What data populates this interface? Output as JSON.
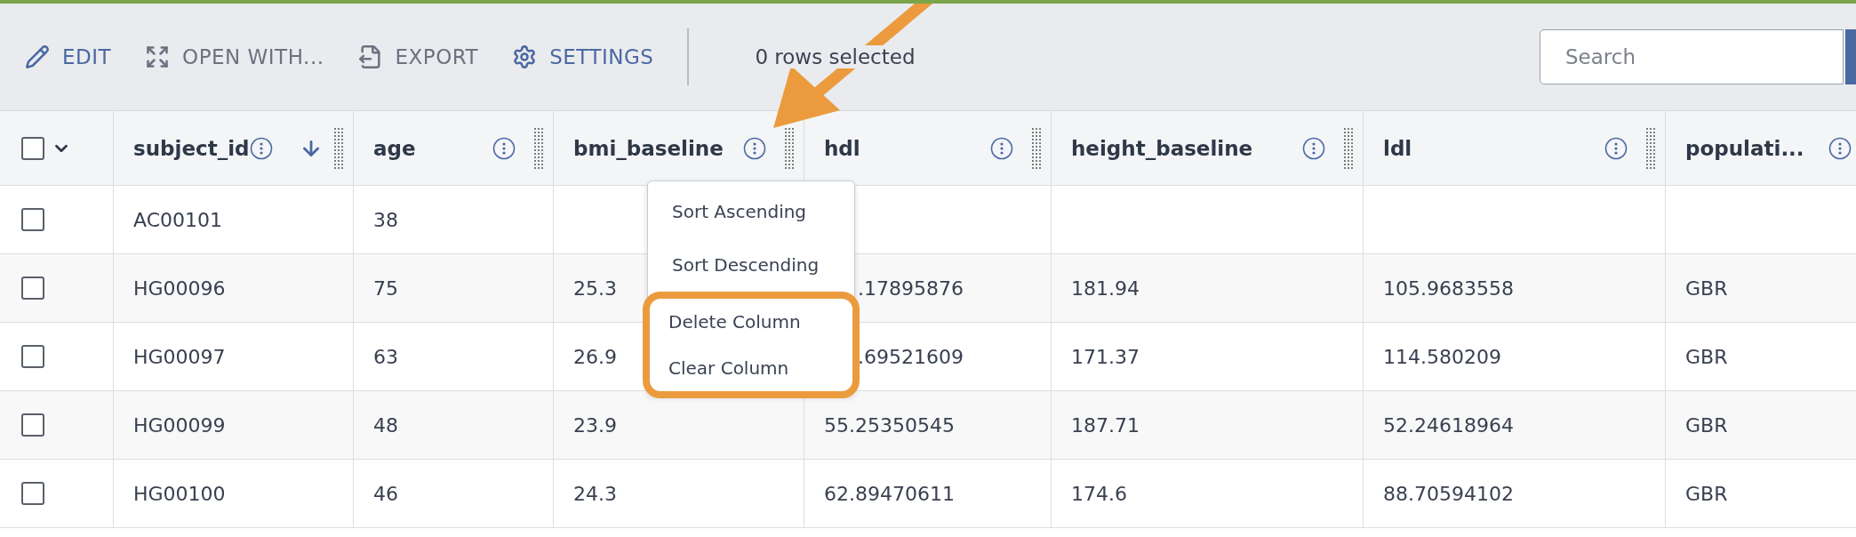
{
  "toolbar": {
    "actions": [
      {
        "label": "EDIT",
        "kind": "edit",
        "accent": true
      },
      {
        "label": "OPEN WITH...",
        "kind": "open",
        "accent": false
      },
      {
        "label": "EXPORT",
        "kind": "export",
        "accent": false
      },
      {
        "label": "SETTINGS",
        "kind": "settings",
        "accent": true
      }
    ],
    "selection_status": "0 rows selected",
    "search": {
      "placeholder": "Search"
    }
  },
  "table": {
    "select_all": {
      "checked": false
    },
    "columns": [
      {
        "label": "subject_id",
        "sorted": true
      },
      {
        "label": "age",
        "sorted": false
      },
      {
        "label": "bmi_baseline",
        "sorted": false
      },
      {
        "label": "hdl",
        "sorted": false
      },
      {
        "label": "height_baseline",
        "sorted": false
      },
      {
        "label": "ldl",
        "sorted": false
      },
      {
        "label": "populati...",
        "sorted": false
      }
    ],
    "rows": [
      {
        "selected": false,
        "menu_covers_hdl": false,
        "cells": [
          "AC00101",
          "38",
          "",
          "",
          "",
          "",
          ""
        ]
      },
      {
        "selected": false,
        "menu_covers_hdl": true,
        "cells": [
          "HG00096",
          "75",
          "25.3",
          ".17895876",
          "181.94",
          "105.9683558",
          "GBR"
        ]
      },
      {
        "selected": false,
        "menu_covers_hdl": true,
        "cells": [
          "HG00097",
          "63",
          "26.9",
          ".69521609",
          "171.37",
          "114.580209",
          "GBR"
        ]
      },
      {
        "selected": false,
        "menu_covers_hdl": false,
        "cells": [
          "HG00099",
          "48",
          "23.9",
          "55.25350545",
          "187.71",
          "52.24618964",
          "GBR"
        ]
      },
      {
        "selected": false,
        "menu_covers_hdl": false,
        "cells": [
          "HG00100",
          "46",
          "24.3",
          "62.89470611",
          "174.6",
          "88.70594102",
          "GBR"
        ]
      }
    ]
  },
  "column_menu": {
    "items": [
      {
        "label": "Sort Ascending",
        "highlighted": false
      },
      {
        "label": "Sort Descending",
        "highlighted": false
      },
      {
        "label": "Delete Column",
        "highlighted": true
      },
      {
        "label": "Clear Column",
        "highlighted": true
      }
    ]
  }
}
